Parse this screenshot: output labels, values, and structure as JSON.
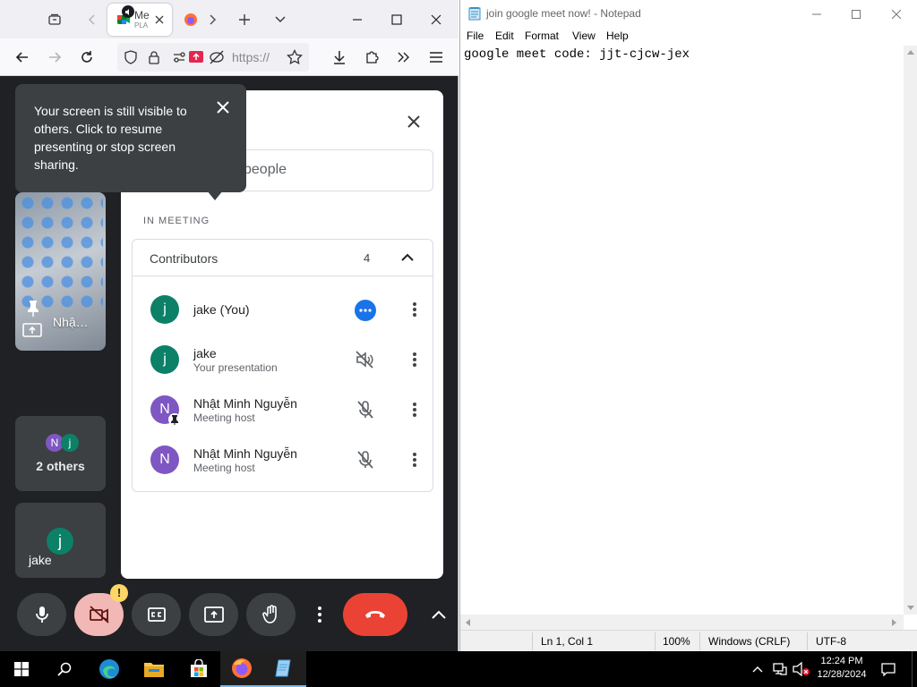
{
  "browser": {
    "tab_title": "Me",
    "tab_subtitle": "PLA",
    "url_text": "https://",
    "meet": {
      "tooltip_text": "Your screen is still visible to others. Click to resume presenting or stop screen sharing.",
      "presentation_tile_label": "Nhậ…",
      "others_tile": {
        "label": "2 others",
        "avatar_initials": [
          "N",
          "j"
        ]
      },
      "self_tile": {
        "name": "jake",
        "initial": "j"
      },
      "people_panel": {
        "search_placeholder": "people",
        "section_label": "IN MEETING",
        "group": {
          "label": "Contributors",
          "count": "4"
        },
        "participants": [
          {
            "initial": "j",
            "name": "jake (You)",
            "sub": "",
            "color": "#0d8068",
            "status_icon": "more-options-blue-icon"
          },
          {
            "initial": "j",
            "name": "jake",
            "sub": "Your presentation",
            "color": "#0d8068",
            "status_icon": "volume-off-icon"
          },
          {
            "initial": "N",
            "name": "Nhật Minh Nguyễn",
            "sub": "Meeting host",
            "color": "#7e57c2",
            "status_icon": "mic-off-icon",
            "pinned": true
          },
          {
            "initial": "N",
            "name": "Nhật Minh Nguyễn",
            "sub": "Meeting host",
            "color": "#7e57c2",
            "status_icon": "mic-off-icon"
          }
        ]
      },
      "controls": [
        {
          "name": "mic-button",
          "icon": "mic-icon"
        },
        {
          "name": "camera-button",
          "icon": "camera-off-icon",
          "badge": "!"
        },
        {
          "name": "captions-button",
          "icon": "closed-captions-icon"
        },
        {
          "name": "present-button",
          "icon": "present-screen-icon"
        },
        {
          "name": "raise-hand-button",
          "icon": "hand-icon"
        },
        {
          "name": "more-options-button",
          "icon": "more-vert-icon"
        },
        {
          "name": "leave-call-button",
          "icon": "phone-hangup-icon"
        },
        {
          "name": "expand-button",
          "icon": "chevron-up-icon"
        }
      ]
    }
  },
  "notepad": {
    "title": "join google meet now! - Notepad",
    "menu": [
      "File",
      "Edit",
      "Format",
      "View",
      "Help"
    ],
    "content": "google meet code: jjt-cjcw-jex",
    "status": {
      "position": "Ln 1, Col 1",
      "zoom": "100%",
      "line_ending": "Windows (CRLF)",
      "encoding": "UTF-8"
    }
  },
  "taskbar": {
    "time": "12:24 PM",
    "date": "12/28/2024",
    "pinned": [
      "start-icon",
      "search-icon",
      "edge-icon",
      "file-explorer-icon",
      "store-icon",
      "firefox-icon",
      "notepad-icon"
    ]
  },
  "colors": {
    "meet_bg": "#202124",
    "tile_bg": "#3c4043",
    "leave_red": "#ea4335",
    "blue_accent": "#1a73e8",
    "camera_off_bg": "#f28b82"
  }
}
